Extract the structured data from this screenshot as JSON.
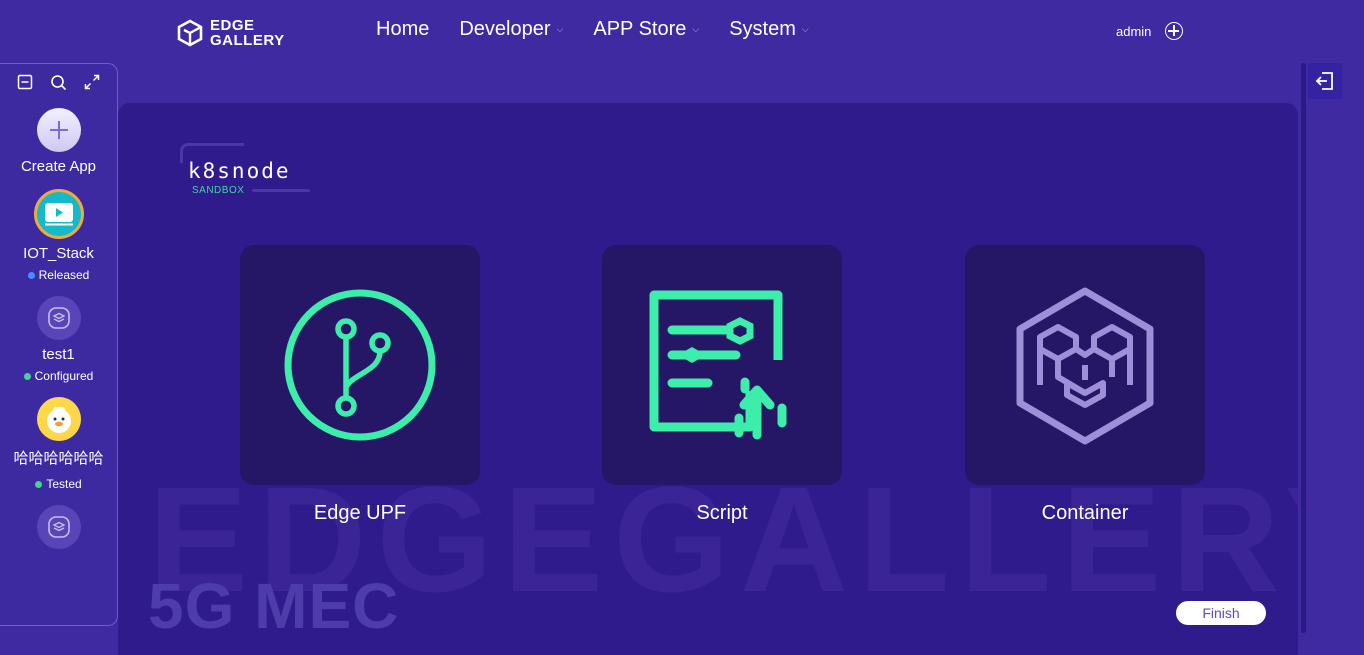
{
  "header": {
    "logo_line1": "EDGE",
    "logo_line2": "GALLERY",
    "nav": [
      "Home",
      "Developer",
      "APP Store",
      "System"
    ],
    "user": "admin"
  },
  "sidebar": {
    "create_label": "Create App",
    "apps": [
      {
        "name": "IOT_Stack",
        "status": "Released",
        "status_color": "#4b8bff"
      },
      {
        "name": "test1",
        "status": "Configured",
        "status_color": "#3fd68c"
      },
      {
        "name": "哈哈哈哈哈哈",
        "status": "Tested",
        "status_color": "#3fd68c"
      }
    ]
  },
  "main": {
    "title": "k8snode",
    "subtitle": "SANDBOX",
    "watermark": "EDGEGALLERY",
    "watermark_sub": "5G MEC",
    "cards": [
      {
        "label": "Edge UPF",
        "icon": "git-branch-icon"
      },
      {
        "label": "Script",
        "icon": "script-upload-icon"
      },
      {
        "label": "Container",
        "icon": "container-cube-icon"
      }
    ],
    "finish_label": "Finish"
  },
  "colors": {
    "accent_green": "#3dedaa",
    "background": "#3f2aa1",
    "panel": "#301b8c"
  }
}
